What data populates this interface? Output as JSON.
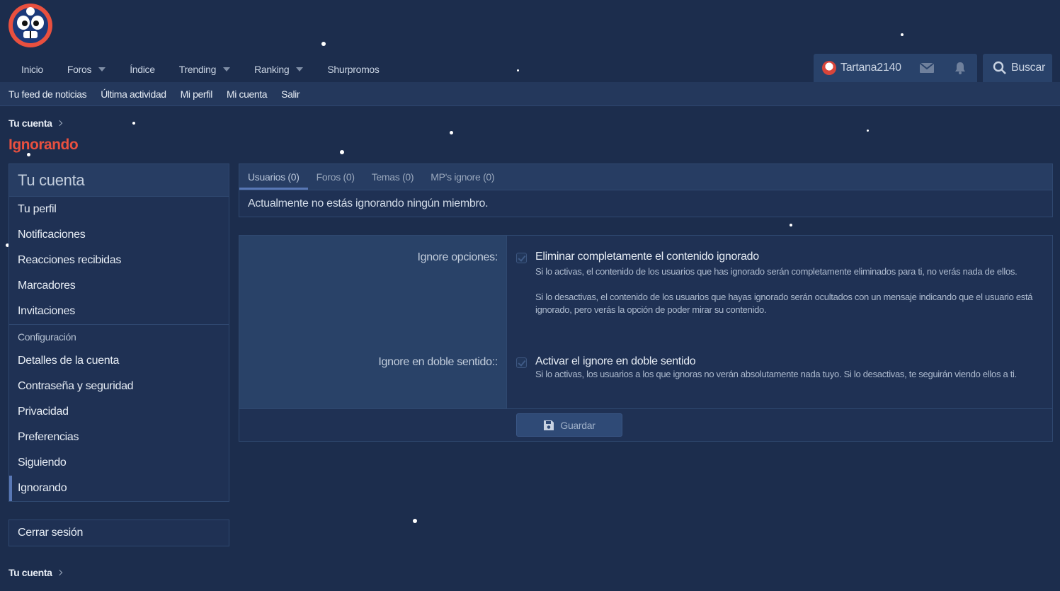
{
  "header": {
    "nav": [
      {
        "label": "Inicio",
        "dropdown": false
      },
      {
        "label": "Foros",
        "dropdown": true
      },
      {
        "label": "Índice",
        "dropdown": false
      },
      {
        "label": "Trending",
        "dropdown": true
      },
      {
        "label": "Ranking",
        "dropdown": true
      },
      {
        "label": "Shurpromos",
        "dropdown": false
      }
    ],
    "user": {
      "username": "Tartana2140"
    },
    "search_label": "Buscar"
  },
  "subnav": [
    "Tu feed de noticias",
    "Última actividad",
    "Mi perfil",
    "Mi cuenta",
    "Salir"
  ],
  "breadcrumb_top": "Tu cuenta",
  "page_title": "Ignorando",
  "sidebar": {
    "title": "Tu cuenta",
    "items": [
      "Tu perfil",
      "Notificaciones",
      "Reacciones recibidas",
      "Marcadores",
      "Invitaciones"
    ],
    "section_label": "Configuración",
    "config_items": [
      "Detalles de la cuenta",
      "Contraseña y seguridad",
      "Privacidad",
      "Preferencias",
      "Siguiendo",
      "Ignorando"
    ],
    "active": "Ignorando"
  },
  "logout_label": "Cerrar sesión",
  "breadcrumb_bottom": "Tu cuenta",
  "tabs": [
    {
      "label": "Usuarios (0)",
      "active": true
    },
    {
      "label": "Foros (0)",
      "active": false
    },
    {
      "label": "Temas (0)",
      "active": false
    },
    {
      "label": "MP's ignore (0)",
      "active": false
    }
  ],
  "tab_message": "Actualmente no estás ignorando ningún miembro.",
  "form": {
    "ignore_options_label": "Ignore opciones:",
    "ignore_options": {
      "title": "Eliminar completamente el contenido ignorado",
      "checked": false,
      "hint1": "Si lo activas, el contenido de los usuarios que has ignorado serán completamente eliminados para ti, no verás nada de ellos.",
      "hint2": "Si lo desactivas, el contenido de los usuarios que hayas ignorado serán ocultados con un mensaje indicando que el usuario está ignorado, pero verás la opción de poder mirar su contenido."
    },
    "double_label": "Ignore en doble sentido::",
    "double": {
      "title": "Activar el ignore en doble sentido",
      "checked": false,
      "hint": "Si lo activas, los usuarios a los que ignoras no verán absolutamente nada tuyo. Si lo desactivas, te seguirán viendo ellos a ti."
    },
    "save_label": "Guardar"
  },
  "colors": {
    "background": "#1c2d4d",
    "accent": "#e9503f",
    "panel": "#1f3154",
    "active_tab": "#5877b5"
  },
  "icons": [
    "clown-logo",
    "mail-icon",
    "bell-icon",
    "search-icon",
    "save-icon"
  ]
}
